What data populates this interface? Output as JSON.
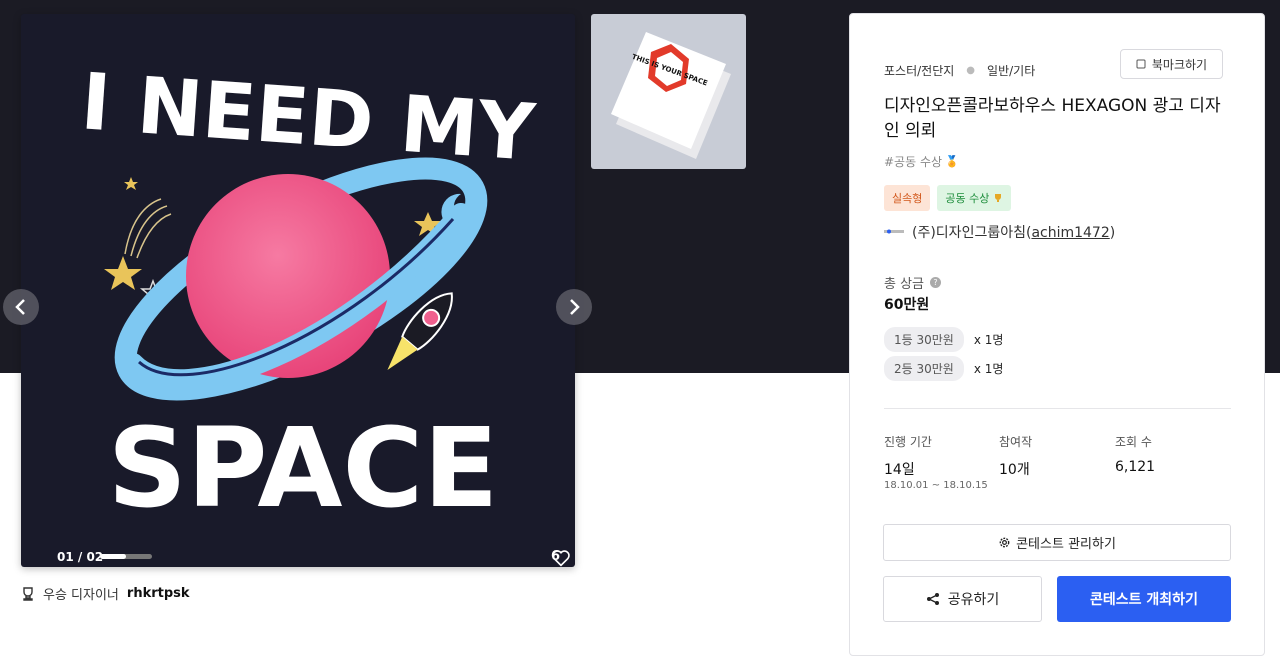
{
  "gallery": {
    "main_image_alt": "I NEED MY SPACE",
    "poster_text_top": "I NEED MY",
    "poster_text_bottom": "SPACE",
    "thumb_text": "THIS IS YOUR SPACE",
    "counter": "01 / 02",
    "progress": 0.5,
    "likes": "6",
    "prev_icon": "chevron-left-icon",
    "next_icon": "chevron-right-icon"
  },
  "winner": {
    "label": "우승 디자이너",
    "name": "rhkrtpsk"
  },
  "panel": {
    "category": "포스터/전단지",
    "subcategory": "일반/기타",
    "bookmark_label": "북마크하기",
    "title": "디자인오픈콜라보하우스 HEXAGON 광고 디자인 의뢰",
    "hashtag": "#공동 수상",
    "badges": [
      "실속형",
      "공동 수상"
    ],
    "host_name": "(주)디자인그룹아침",
    "host_id": "achim1472",
    "prize_label": "총 상금",
    "prize_total": "60만원",
    "prizes": [
      {
        "label": "1등 30만원",
        "count": "x 1명"
      },
      {
        "label": "2등 30만원",
        "count": "x 1명"
      }
    ],
    "stats": [
      {
        "label": "진행 기간",
        "value": "14일"
      },
      {
        "label": "참여작",
        "value": "10개"
      },
      {
        "label": "조회 수",
        "value": "6,121"
      }
    ],
    "period_dates": "18.10.01 ~ 18.10.15",
    "manage_label": "콘테스트 관리하기",
    "share_label": "공유하기",
    "host_contest_label": "콘테스트 개최하기"
  },
  "colors": {
    "accent": "#2b5ff2",
    "dark_band": "#1b1b24",
    "planet": "#f0608e",
    "ring": "#7ec8f2"
  }
}
